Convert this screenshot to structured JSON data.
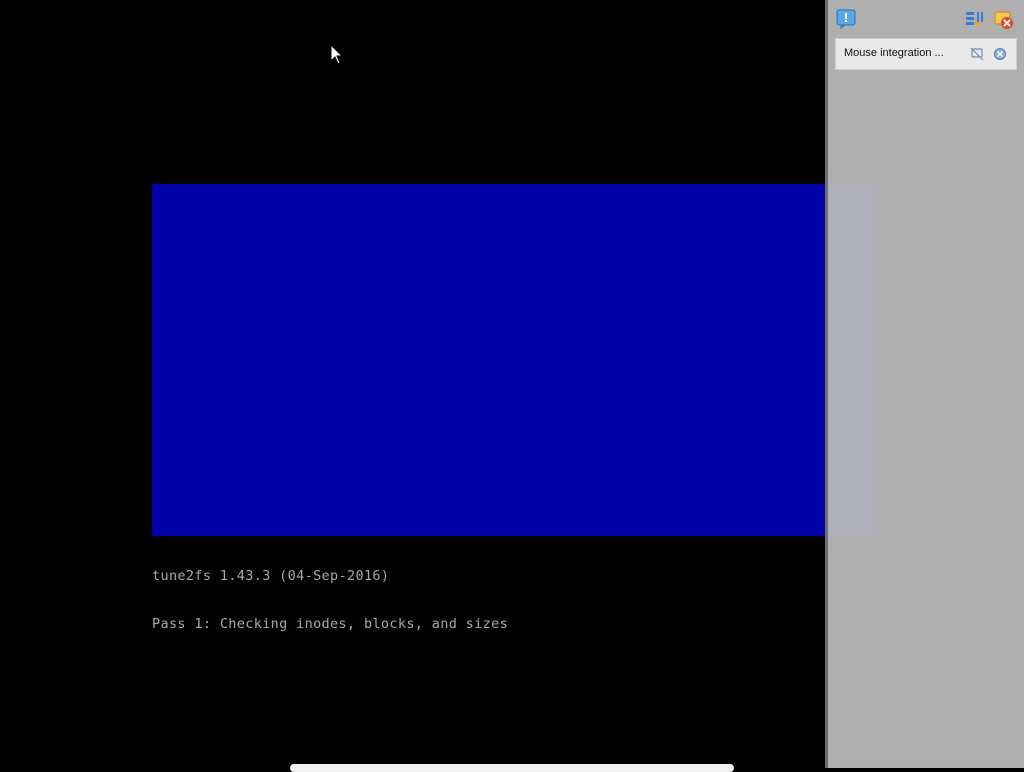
{
  "console": {
    "lines": [
      "tune2fs 1.43.3 (04-Sep-2016)",
      "Pass 1: Checking inodes, blocks, and sizes"
    ],
    "box_color": "#0000aa",
    "text_color": "#a8a8a8"
  },
  "notification_panel": {
    "toolbar": {
      "icons": [
        "notification-center-icon",
        "arrange-icon",
        "dismiss-all-icon"
      ]
    },
    "notification": {
      "text": "Mouse integration ...",
      "icons": [
        "do-not-show-again-icon",
        "close-notification-icon"
      ]
    }
  }
}
